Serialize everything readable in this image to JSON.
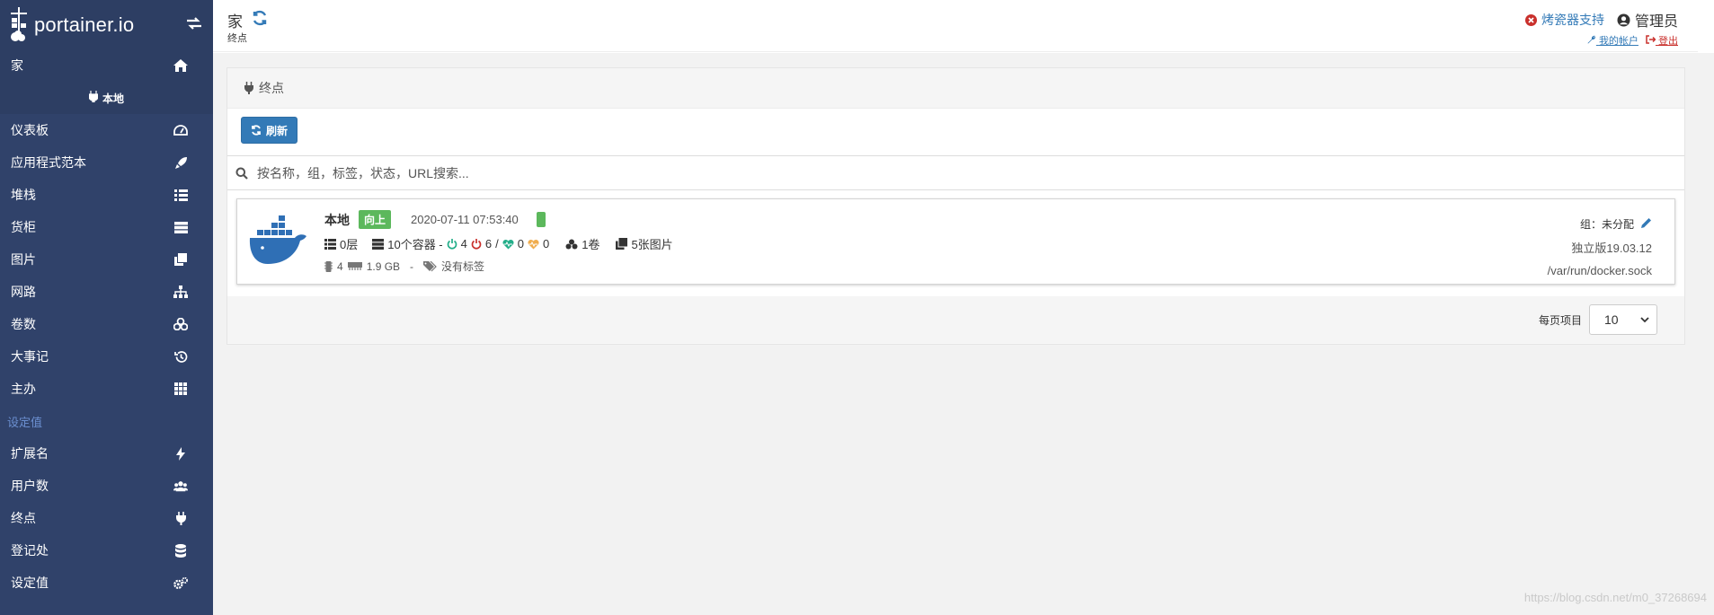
{
  "brand": {
    "name": "portainer.io"
  },
  "sidebar": {
    "home_label": "家",
    "endpoint_label": "本地",
    "items": [
      {
        "label": "仪表板",
        "icon": "dashboard-icon"
      },
      {
        "label": "应用程式范本",
        "icon": "rocket-icon"
      },
      {
        "label": "堆栈",
        "icon": "list-icon"
      },
      {
        "label": "货柜",
        "icon": "server-icon"
      },
      {
        "label": "图片",
        "icon": "clone-icon"
      },
      {
        "label": "网路",
        "icon": "sitemap-icon"
      },
      {
        "label": "卷数",
        "icon": "cubes-icon"
      },
      {
        "label": "大事记",
        "icon": "history-icon"
      },
      {
        "label": "主办",
        "icon": "grid-icon"
      }
    ],
    "settings_section": "设定值",
    "settings_items": [
      {
        "label": "扩展名",
        "icon": "bolt-icon"
      },
      {
        "label": "用户数",
        "icon": "users-icon"
      },
      {
        "label": "终点",
        "icon": "plug-icon"
      },
      {
        "label": "登记处",
        "icon": "database-icon"
      },
      {
        "label": "设定值",
        "icon": "cogs-icon"
      }
    ]
  },
  "header": {
    "title": "家",
    "subtitle": "终点",
    "support": "烤瓷器支持",
    "user": "管理员",
    "my_account": "我的帐户",
    "logout": "登出"
  },
  "panel": {
    "title": "终点",
    "refresh": "刷新",
    "search_placeholder": "按名称，组，标签，状态，URL搜索..."
  },
  "endpoint": {
    "name": "本地",
    "status": "向上",
    "time": "2020-07-11 07:53:40",
    "stacks": "0层",
    "containers": "10个容器 -",
    "running": "4",
    "stopped": "6",
    "slash": "/",
    "healthy": "0",
    "unhealthy": "0",
    "volumes": "1卷",
    "images": "5张图片",
    "cpu": "4",
    "memory": "1.9 GB",
    "dash": "-",
    "tags": "没有标签",
    "group": "组：未分配",
    "docker": "独立版19.03.12",
    "socket": "/var/run/docker.sock"
  },
  "pagination": {
    "label": "每页项目",
    "value": "10"
  },
  "watermark": "https://blog.csdn.net/m0_37268694",
  "colors": {
    "sidebar": "#30426a",
    "primary": "#337ab7",
    "success": "#5cb85c"
  }
}
